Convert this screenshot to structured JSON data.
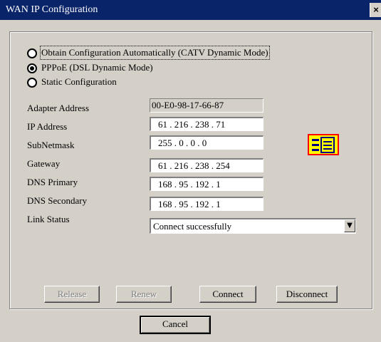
{
  "window": {
    "title": "WAN IP Configuration",
    "close_glyph": "×"
  },
  "modes": [
    {
      "label": "Obtain Configuration Automatically (CATV Dynamic Mode)",
      "checked": false
    },
    {
      "label": "PPPoE (DSL Dynamic Mode)",
      "checked": true
    },
    {
      "label": "Static Configuration",
      "checked": false
    }
  ],
  "fields": {
    "adapter": {
      "label": "Adapter Address",
      "value": "00-E0-98-17-66-87"
    },
    "ip": {
      "label": "IP Address",
      "value": "61 . 216 . 238 . 71"
    },
    "subnet": {
      "label": "SubNetmask",
      "value": "255 . 0 . 0 . 0"
    },
    "gateway": {
      "label": "Gateway",
      "value": "61 . 216 . 238 . 254"
    },
    "dns1": {
      "label": "DNS Primary",
      "value": "168 . 95 . 192 . 1"
    },
    "dns2": {
      "label": "DNS Secondary",
      "value": "168 . 95 . 192 . 1"
    },
    "link": {
      "label": "Link Status",
      "value": "Connect successfully"
    }
  },
  "buttons": {
    "release": "Release",
    "renew": "Renew",
    "connect": "Connect",
    "disconnect": "Disconnect",
    "cancel": "Cancel"
  },
  "icons": {
    "status": "network-status-icon",
    "close": "close-icon",
    "dropdown": "chevron-down-icon"
  },
  "colors": {
    "titlebar": "#0a246a",
    "dialog": "#d4d0c8",
    "status_icon_fill": "#ffff00",
    "status_icon_border": "#ff0000"
  }
}
